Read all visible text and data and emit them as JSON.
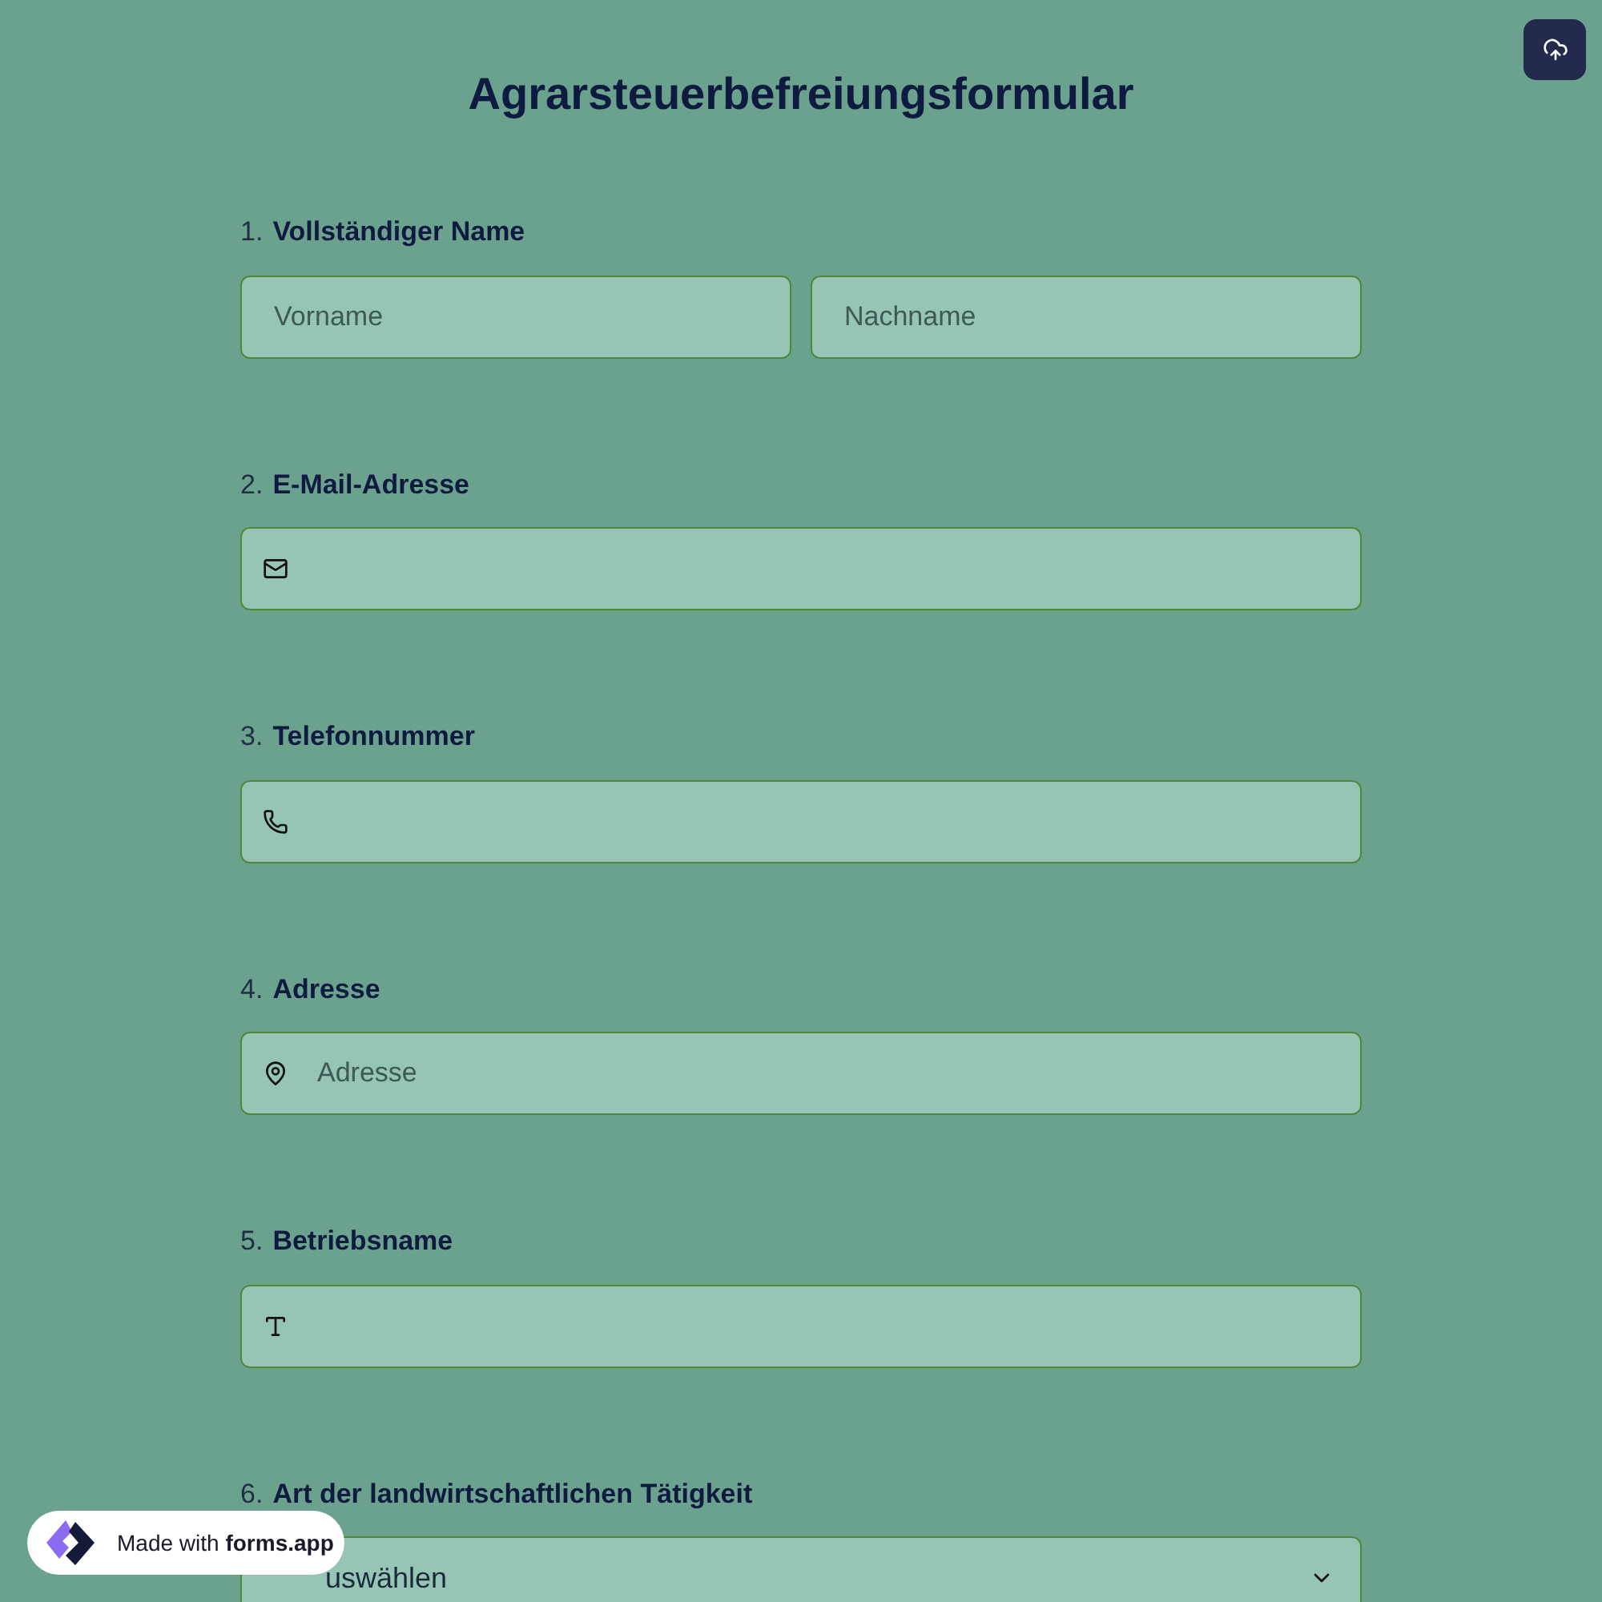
{
  "title": "Agrarsteuerbefreiungsformular",
  "questions": [
    {
      "number": "1.",
      "label": "Vollständiger Name",
      "kind": "name",
      "placeholders": [
        "Vorname",
        "Nachname"
      ]
    },
    {
      "number": "2.",
      "label": "E-Mail-Adresse",
      "kind": "email"
    },
    {
      "number": "3.",
      "label": "Telefonnummer",
      "kind": "phone"
    },
    {
      "number": "4.",
      "label": "Adresse",
      "kind": "address",
      "placeholder": "Adresse"
    },
    {
      "number": "5.",
      "label": "Betriebsname",
      "kind": "text"
    },
    {
      "number": "6.",
      "label": "Art der landwirtschaftlichen Tätigkeit",
      "kind": "select",
      "value": "uswählen"
    }
  ],
  "badge": {
    "prefix": "Made with",
    "brand": "forms.app"
  }
}
